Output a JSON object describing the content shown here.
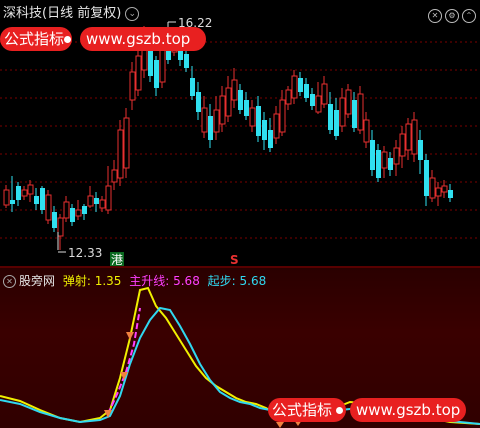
{
  "header": {
    "title": "深科技(日线 前复权)",
    "dropdown_icon": "chevron-down-icon"
  },
  "top_icons": [
    "close-icon",
    "gear-icon",
    "chevron-up-icon"
  ],
  "watermark_top": {
    "label": "公式指标",
    "url": "www.gszb.top"
  },
  "watermark_bottom": {
    "label": "公式指标",
    "url": "www.gszb.top"
  },
  "price": {
    "high_label": "16.22",
    "low_label": "12.33"
  },
  "markers": {
    "hk": "港",
    "s": "S"
  },
  "indicator": {
    "name": "股旁网",
    "tan_label": "弹射: 1.35",
    "main_label": "主升线: 5.68",
    "start_label": "起步: 5.68"
  },
  "colors": {
    "up": "#e83030",
    "down": "#30e0f0",
    "yellow": "#f0f000",
    "cyan": "#30d8f0",
    "magenta": "#ff40ff",
    "badge": "#e82020"
  }
}
